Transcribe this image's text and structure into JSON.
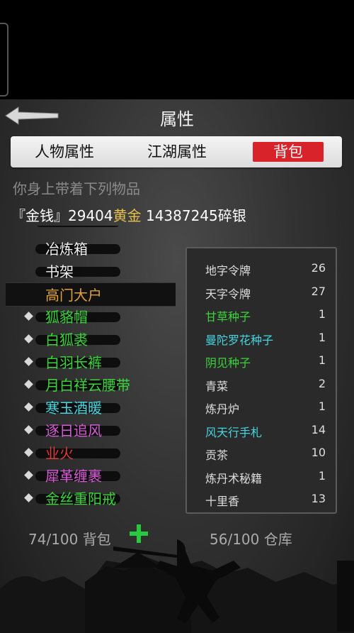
{
  "header": {
    "title": "属性"
  },
  "tabs": {
    "character": "人物属性",
    "jianghu": "江湖属性",
    "bag": "背包"
  },
  "subtitle": "你身上带着下列物品",
  "money": {
    "prefix": "『金钱』",
    "gold_amount": "29404",
    "gold_unit": "黄金",
    "silver_amount": " 14387245",
    "silver_unit": "碎银"
  },
  "left_items": [
    {
      "label": "冶炼箱",
      "color": "#f0f0f0",
      "marker": false,
      "selected": false
    },
    {
      "label": "书架",
      "color": "#f0f0f0",
      "marker": false,
      "selected": false
    },
    {
      "label": "高门大户",
      "color": "#e0a23a",
      "marker": false,
      "selected": true
    },
    {
      "label": "狐貉帽",
      "color": "#3ad43a",
      "marker": true,
      "selected": false
    },
    {
      "label": "白狐裘",
      "color": "#3ad43a",
      "marker": true,
      "selected": false
    },
    {
      "label": "白羽长裤",
      "color": "#3ad43a",
      "marker": true,
      "selected": false
    },
    {
      "label": "月白祥云腰带",
      "color": "#3ad43a",
      "marker": true,
      "selected": false
    },
    {
      "label": "寒玉酒暖",
      "color": "#45d6e0",
      "marker": true,
      "selected": false
    },
    {
      "label": "逐日追风",
      "color": "#d75ad7",
      "marker": true,
      "selected": false
    },
    {
      "label": "业火",
      "color": "#e03a3a",
      "marker": true,
      "selected": false
    },
    {
      "label": "犀革缠裹",
      "color": "#d75ad7",
      "marker": true,
      "selected": false
    },
    {
      "label": "金丝重阳戒",
      "color": "#3ad43a",
      "marker": true,
      "selected": false
    }
  ],
  "right_items": [
    {
      "name": "地字令牌",
      "count": "26",
      "color": "#dddddd"
    },
    {
      "name": "天字令牌",
      "count": "27",
      "color": "#dddddd"
    },
    {
      "name": "甘草种子",
      "count": "1",
      "color": "#3ad43a"
    },
    {
      "name": "曼陀罗花种子",
      "count": "1",
      "color": "#45d6e0"
    },
    {
      "name": "阴见种子",
      "count": "1",
      "color": "#3ad43a"
    },
    {
      "name": "青菜",
      "count": "2",
      "color": "#dddddd"
    },
    {
      "name": "炼丹炉",
      "count": "1",
      "color": "#dddddd"
    },
    {
      "name": "风天行手札",
      "count": "14",
      "color": "#45d6e0"
    },
    {
      "name": "贡茶",
      "count": "10",
      "color": "#dddddd"
    },
    {
      "name": "炼丹术秘籍",
      "count": "1",
      "color": "#dddddd"
    },
    {
      "name": "十里香",
      "count": "13",
      "color": "#dddddd"
    }
  ],
  "footer": {
    "bag_capacity": "74/100 背包",
    "warehouse_capacity": "56/100 仓库"
  },
  "icons": {
    "back": "back-arrow-icon",
    "expand": "plus-icon"
  },
  "colors": {
    "accent": "#d8232a",
    "plus": "#27c93f"
  }
}
